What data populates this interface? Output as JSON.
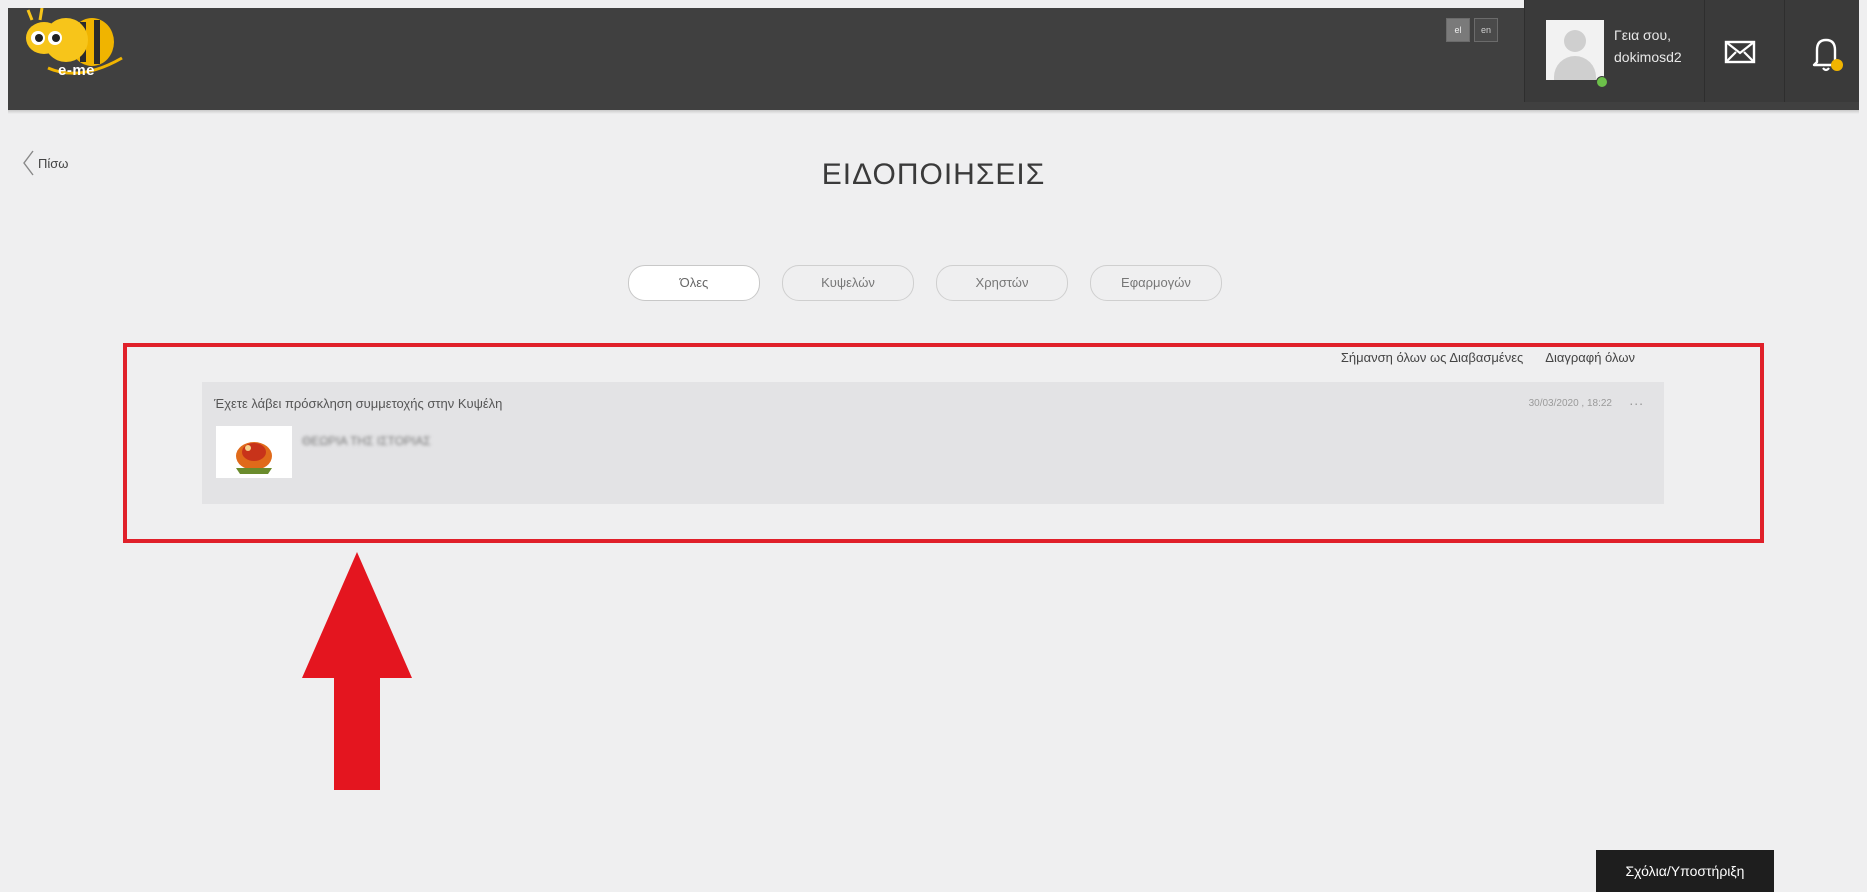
{
  "app": {
    "logo_text": "e-me"
  },
  "topbar": {
    "languages": [
      {
        "code": "el",
        "active": true
      },
      {
        "code": "en",
        "active": false
      }
    ],
    "user": {
      "greeting": "Γεια σου,",
      "username": "dokimosd2",
      "status": "online"
    },
    "icons": [
      "mail-icon",
      "bell-icon"
    ]
  },
  "header": {
    "back_label": "Πίσω",
    "title": "ΕΙΔΟΠΟΙΗΣΕΙΣ"
  },
  "tabs": [
    {
      "label": "Όλες",
      "active": true
    },
    {
      "label": "Κυψελών",
      "active": false
    },
    {
      "label": "Χρηστών",
      "active": false
    },
    {
      "label": "Εφαρμογών",
      "active": false
    }
  ],
  "notifications": {
    "mark_all_read_label": "Σήμανση όλων ως Διαβασμένες",
    "delete_all_label": "Διαγραφή όλων",
    "items": [
      {
        "text": "Έχετε λάβει πρόσκληση συμμετοχής στην Κυψέλη",
        "timestamp": "30/03/2020 , 18:22",
        "more": "...",
        "hive_name": "ΘΕΩΡΙΑ ΤΗΣ ΙΣΤΟΡΙΑΣ"
      }
    ]
  },
  "feedback": {
    "label": "Σχόλια/Υποστήριξη"
  },
  "colors": {
    "topbar": "#404040",
    "background": "#efeff0",
    "highlight": "#e0202a",
    "arrow": "#e4151f",
    "card": "#e3e3e5"
  }
}
